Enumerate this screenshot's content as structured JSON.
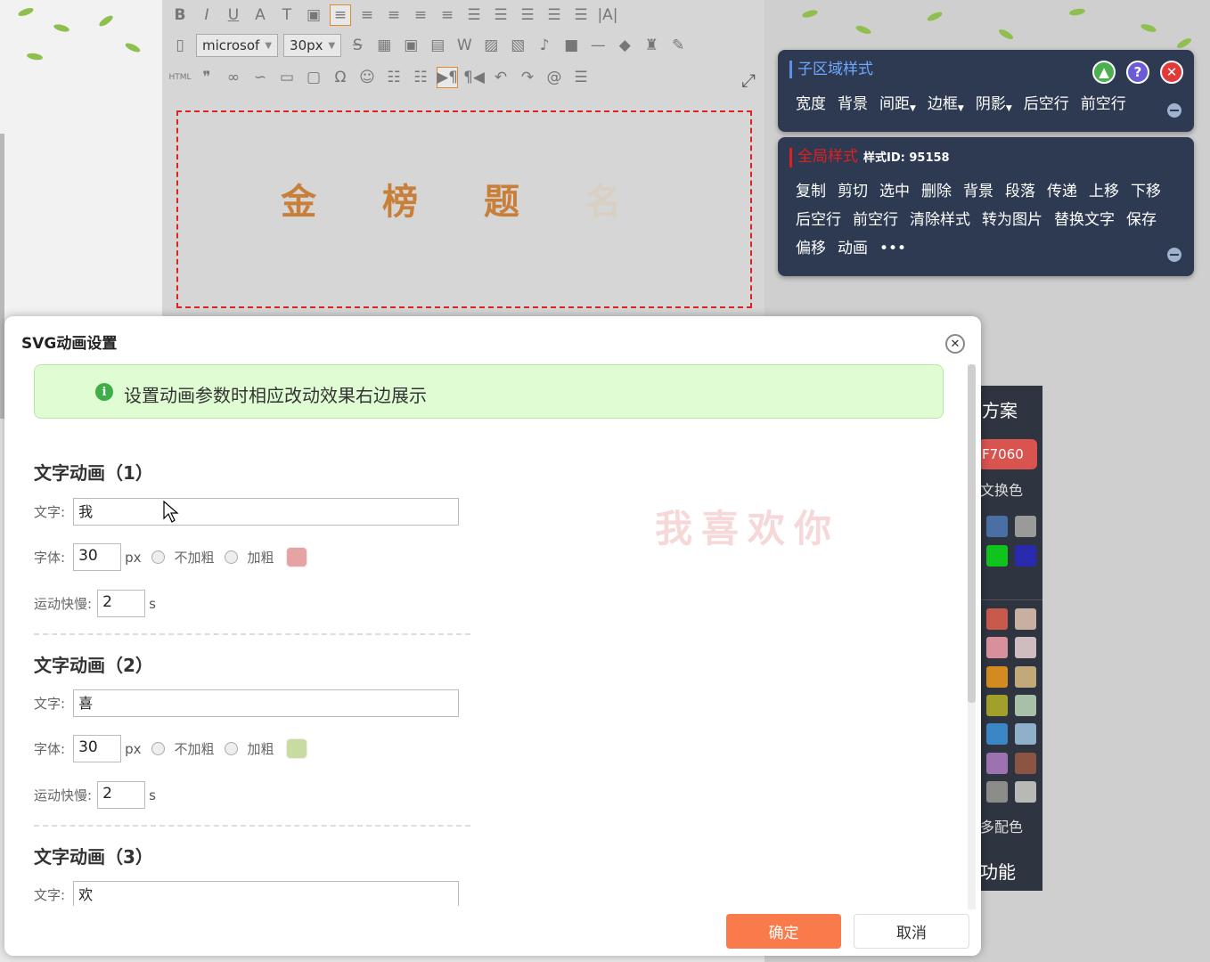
{
  "editor": {
    "font_family": "microsof",
    "font_size": "30px",
    "html_label": "HTML",
    "title_text_main": "金 榜 题",
    "title_text_faded": "名"
  },
  "panel_sub": {
    "title": "子区域样式",
    "items": [
      "宽度",
      "背景",
      "间距",
      "边框",
      "阴影",
      "后空行",
      "前空行"
    ]
  },
  "panel_global": {
    "title": "全局样式",
    "style_id_label": "样式ID: 95158",
    "items": [
      "复制",
      "剪切",
      "选中",
      "删除",
      "背景",
      "段落",
      "传递",
      "上移",
      "下移",
      "后空行",
      "前空行",
      "清除样式",
      "转为图片",
      "替换文字",
      "保存",
      "偏移",
      "动画",
      "•••"
    ]
  },
  "side": {
    "title": "方案",
    "code": "F7060",
    "label1": "文换色",
    "label2": "多配色",
    "label3": "功能"
  },
  "modal": {
    "title": "SVG动画设置",
    "notice": "设置动画参数时相应改动效果右边展示",
    "text_label": "文字:",
    "font_label": "字体:",
    "speed_label": "运动快慢:",
    "px_unit": "px",
    "s_unit": "s",
    "no_bold": "不加粗",
    "bold": "加粗",
    "groups": [
      {
        "title": "文字动画（1）",
        "text": "我",
        "size": "30",
        "speed": "2",
        "color": "#e5a3a3"
      },
      {
        "title": "文字动画（2）",
        "text": "喜",
        "size": "30",
        "speed": "2",
        "color": "#c8dca2"
      },
      {
        "title": "文字动画（3）",
        "text": "欢"
      }
    ],
    "preview": "我喜欢你",
    "ok_button": "确定",
    "cancel_button": "取消"
  },
  "colors": {
    "accent_orange": "#f97a4a",
    "panel_bg": "#2d3a52",
    "notice_bg": "#dffcd3"
  }
}
